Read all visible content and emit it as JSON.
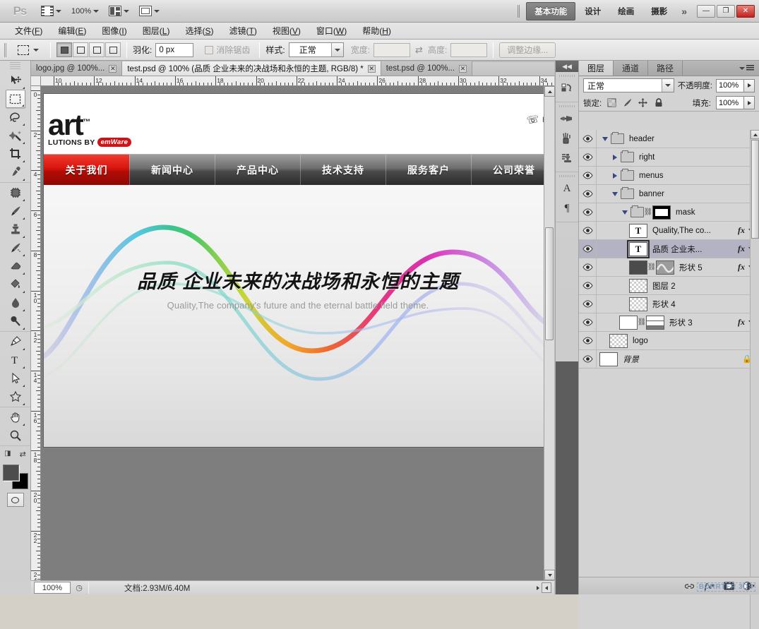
{
  "app": {
    "name": "Ps",
    "zoom_level": "100%",
    "workspaces": [
      {
        "label": "基本功能",
        "active": true
      },
      {
        "label": "设计",
        "active": false
      },
      {
        "label": "绘画",
        "active": false
      },
      {
        "label": "摄影",
        "active": false
      }
    ],
    "more_workspaces": "»",
    "window_buttons": {
      "minimize": "—",
      "maximize": "❐",
      "close": "✕"
    }
  },
  "menubar": [
    {
      "label": "文件",
      "accel": "F"
    },
    {
      "label": "编辑",
      "accel": "E"
    },
    {
      "label": "图像",
      "accel": "I"
    },
    {
      "label": "图层",
      "accel": "L"
    },
    {
      "label": "选择",
      "accel": "S"
    },
    {
      "label": "滤镜",
      "accel": "T"
    },
    {
      "label": "视图",
      "accel": "V"
    },
    {
      "label": "窗口",
      "accel": "W"
    },
    {
      "label": "帮助",
      "accel": "H"
    }
  ],
  "options_bar": {
    "feather_label": "羽化:",
    "feather_value": "0 px",
    "antialias_label": "消除锯齿",
    "antialias_checked": false,
    "style_label": "样式:",
    "style_value": "正常",
    "width_label": "宽度:",
    "width_value": "",
    "swap_icon": "⇄",
    "height_label": "高度:",
    "height_value": "",
    "refine_edge_label": "调整边缘..."
  },
  "toolbar": {
    "tools": [
      {
        "name": "move-tool",
        "glyph": "move"
      },
      {
        "name": "rectangular-marquee-tool",
        "glyph": "marquee",
        "selected": true
      },
      {
        "name": "lasso-tool",
        "glyph": "lasso"
      },
      {
        "name": "magic-wand-tool",
        "glyph": "wand"
      },
      {
        "name": "crop-tool",
        "glyph": "crop"
      },
      {
        "name": "eyedropper-tool",
        "glyph": "eyedropper"
      },
      {
        "name": "spot-healing-brush-tool",
        "glyph": "healing"
      },
      {
        "name": "brush-tool",
        "glyph": "brush"
      },
      {
        "name": "clone-stamp-tool",
        "glyph": "stamp"
      },
      {
        "name": "history-brush-tool",
        "glyph": "historybrush"
      },
      {
        "name": "eraser-tool",
        "glyph": "eraser"
      },
      {
        "name": "gradient-tool",
        "glyph": "paintbucket"
      },
      {
        "name": "blur-tool",
        "glyph": "blur"
      },
      {
        "name": "dodge-tool",
        "glyph": "dodge"
      },
      {
        "name": "pen-tool",
        "glyph": "pen"
      },
      {
        "name": "horizontal-type-tool",
        "glyph": "type"
      },
      {
        "name": "path-selection-tool",
        "glyph": "pathselect"
      },
      {
        "name": "custom-shape-tool",
        "glyph": "shape"
      },
      {
        "name": "hand-tool",
        "glyph": "hand"
      },
      {
        "name": "zoom-tool",
        "glyph": "zoom"
      }
    ],
    "foreground_color": "#4d4d4d",
    "background_color": "#000000"
  },
  "document_tabs": [
    {
      "label": "logo.jpg @ 100%...",
      "active": false,
      "close": "✕"
    },
    {
      "label": "test.psd @ 100% (品质 企业未来的决战场和永恒的主题, RGB/8) *",
      "active": true,
      "close": "✕"
    },
    {
      "label": "test.psd @ 100%...",
      "active": false,
      "close": "✕"
    }
  ],
  "rulers": {
    "unit": "cm",
    "horizontal_ticks": [
      "10",
      "12",
      "14",
      "16",
      "18",
      "20",
      "22",
      "24",
      "26",
      "28",
      "30",
      "32",
      "34"
    ],
    "vertical_ticks": [
      "0",
      "2",
      "4",
      "6",
      "8",
      "10",
      "12",
      "14",
      "16",
      "18",
      "20",
      "22",
      "24"
    ]
  },
  "canvas": {
    "site": {
      "logo": {
        "word": "art",
        "tm": "™",
        "tagline": "LUTIONS BY",
        "brand": "emWare",
        "brand_accent": "#cf1417"
      },
      "header_right_text": "H",
      "nav": [
        {
          "label": "关于我们",
          "active": true
        },
        {
          "label": "新闻中心",
          "active": false
        },
        {
          "label": "产品中心",
          "active": false
        },
        {
          "label": "技术支持",
          "active": false
        },
        {
          "label": "服务客户",
          "active": false
        },
        {
          "label": "公司荣誉",
          "active": false
        }
      ],
      "banner": {
        "headline_cn": "品质 企业未来的决战场和永恒的主题",
        "headline_en": "Quality,The company's future and the eternal battle field theme."
      }
    }
  },
  "status_bar": {
    "zoom": "100%",
    "doc_label": "文档:2.93M/6.40M"
  },
  "dock_strip": {
    "collapse_icon": "◀◀",
    "icons": [
      {
        "name": "history-panel-icon"
      },
      {
        "name": "adjustments-panel-icon"
      },
      {
        "name": "brush-panel-icon"
      },
      {
        "name": "clone-source-panel-icon"
      },
      {
        "name": "character-panel-icon",
        "glyph": "A"
      },
      {
        "name": "paragraph-panel-icon",
        "glyph": "¶"
      }
    ]
  },
  "layers_panel": {
    "tabs": [
      {
        "label": "图层",
        "active": true
      },
      {
        "label": "通道",
        "active": false
      },
      {
        "label": "路径",
        "active": false
      }
    ],
    "blend_mode": "正常",
    "opacity_label": "不透明度:",
    "opacity_value": "100%",
    "lock_label": "锁定:",
    "fill_label": "填充:",
    "fill_value": "100%",
    "lock_icons": [
      "transparent-pixels",
      "image-pixels",
      "position",
      "all"
    ],
    "layers": [
      {
        "name": "header",
        "type": "group",
        "indent": 0,
        "visible": true,
        "expanded": true,
        "selected": false,
        "has_fx": false
      },
      {
        "name": "right",
        "type": "group",
        "indent": 1,
        "visible": true,
        "expanded": false,
        "selected": false,
        "has_fx": false
      },
      {
        "name": "menus",
        "type": "group",
        "indent": 1,
        "visible": true,
        "expanded": false,
        "selected": false,
        "has_fx": false
      },
      {
        "name": "banner",
        "type": "group",
        "indent": 1,
        "visible": true,
        "expanded": true,
        "selected": false,
        "has_fx": false
      },
      {
        "name": "mask",
        "type": "group-mask",
        "indent": 2,
        "visible": true,
        "expanded": true,
        "selected": false,
        "has_fx": false
      },
      {
        "name": "Quality,The co...",
        "type": "text",
        "indent": 3,
        "visible": true,
        "selected": false,
        "has_fx": true
      },
      {
        "name": "品质 企业未...",
        "type": "text",
        "indent": 3,
        "visible": true,
        "selected": true,
        "has_fx": true
      },
      {
        "name": "形状 5",
        "type": "shape",
        "indent": 3,
        "visible": true,
        "selected": false,
        "has_fx": true
      },
      {
        "name": "图层 2",
        "type": "pixel",
        "indent": 3,
        "visible": true,
        "selected": false,
        "has_fx": false
      },
      {
        "name": "形状 4",
        "type": "pixel",
        "indent": 3,
        "visible": true,
        "selected": false,
        "has_fx": false
      },
      {
        "name": "形状 3",
        "type": "shape-mask",
        "indent": 2,
        "visible": true,
        "selected": false,
        "has_fx": true
      },
      {
        "name": "logo",
        "type": "pixel",
        "indent": 1,
        "visible": true,
        "selected": false,
        "has_fx": false
      },
      {
        "name": "背景",
        "type": "background",
        "indent": 0,
        "visible": true,
        "selected": false,
        "has_fx": false,
        "locked": true
      }
    ],
    "footer_buttons": [
      {
        "name": "link-layers-button",
        "glyph": "⛓"
      },
      {
        "name": "layer-style-button",
        "glyph": "fx"
      },
      {
        "name": "layer-mask-button",
        "glyph": "◙"
      },
      {
        "name": "adjustment-layer-button",
        "glyph": "◑"
      },
      {
        "name": "new-group-button",
        "glyph": "▭"
      },
      {
        "name": "new-layer-button",
        "glyph": "▤"
      },
      {
        "name": "delete-layer-button",
        "glyph": "🗑"
      }
    ],
    "watermark": "BORRTER 3DS"
  }
}
